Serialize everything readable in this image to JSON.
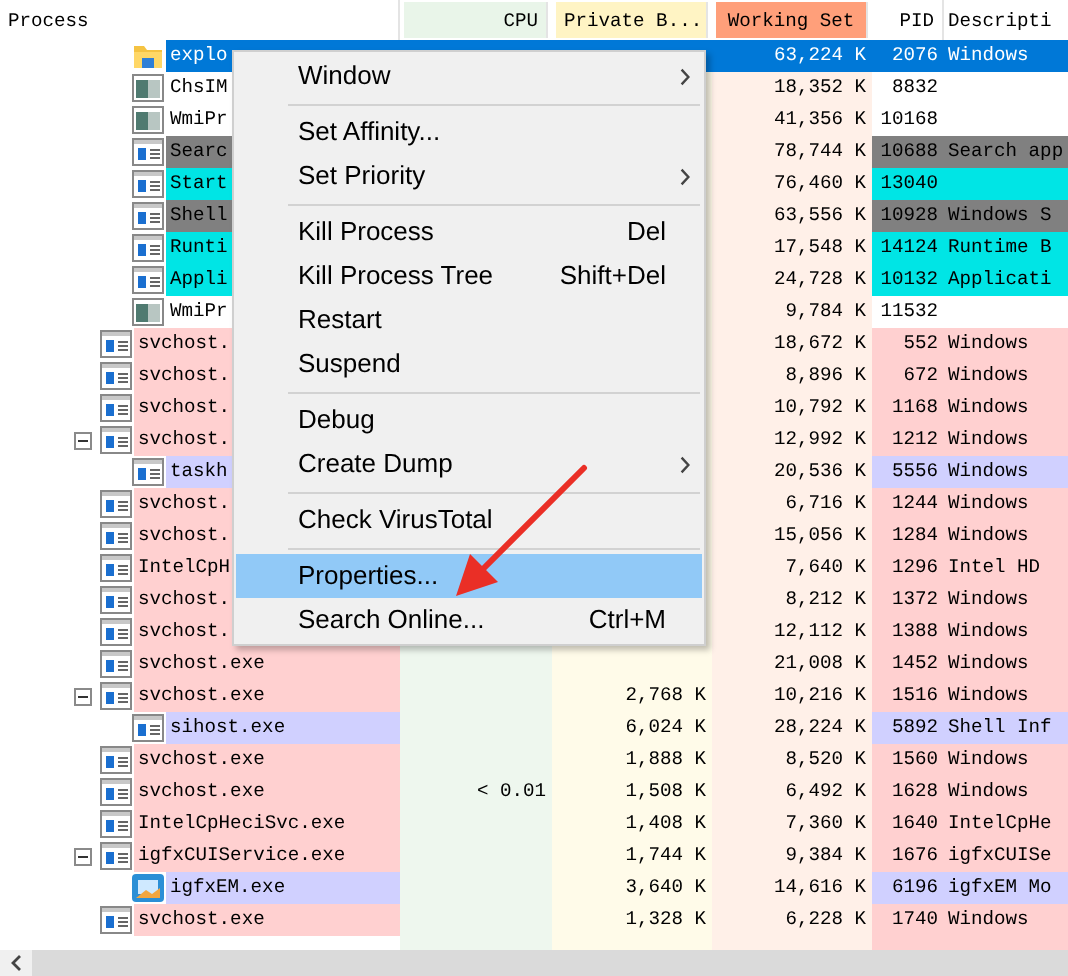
{
  "table": {
    "columns": [
      "Process",
      "CPU",
      "Private B...",
      "Working Set",
      "PID",
      "Descripti"
    ],
    "continued_children": [
      {
        "name": "explo",
        "kind": "folder",
        "selected": true,
        "working_set": "63,224 K",
        "pid": "2076",
        "description": "Windows"
      },
      {
        "name": "ChsIM",
        "kind": "app",
        "selected": false,
        "color": "#ffffff",
        "working_set": "18,352 K",
        "pid": "8832"
      },
      {
        "name": "WmiPr",
        "kind": "app",
        "selected": false,
        "color": "#ffffff",
        "working_set": "41,356 K",
        "pid": "10168"
      },
      {
        "name": "Searc",
        "kind": "service",
        "selected": false,
        "color": "#808080",
        "working_set": "78,744 K",
        "pid": "10688",
        "description": "Search app"
      },
      {
        "name": "Start",
        "kind": "service",
        "selected": false,
        "color": "#00e5e5",
        "working_set": "76,460 K",
        "pid": "13040"
      },
      {
        "name": "Shell",
        "kind": "service",
        "selected": false,
        "color": "#808080",
        "working_set": "63,556 K",
        "pid": "10928",
        "description": "Windows S"
      },
      {
        "name": "Runti",
        "kind": "service",
        "selected": false,
        "color": "#00e5e5",
        "working_set": "17,548 K",
        "pid": "14124",
        "description": "Runtime B"
      },
      {
        "name": "Appli",
        "kind": "service",
        "selected": false,
        "color": "#00e5e5",
        "working_set": "24,728 K",
        "pid": "10132",
        "description": "Applicati"
      },
      {
        "name": "WmiPr",
        "kind": "app",
        "selected": false,
        "color": "#ffffff",
        "working_set": "9,784 K",
        "pid": "11532"
      }
    ],
    "rows": [
      {
        "name": "svchost.",
        "kind": "service",
        "selected": false,
        "color": "#ffd0d0",
        "working_set": "18,672 K",
        "pid": "552",
        "description": "Windows"
      },
      {
        "name": "svchost.",
        "kind": "service",
        "selected": false,
        "color": "#ffd0d0",
        "working_set": "8,896 K",
        "pid": "672",
        "description": "Windows"
      },
      {
        "name": "svchost.",
        "kind": "service",
        "selected": false,
        "color": "#ffd0d0",
        "working_set": "10,792 K",
        "pid": "1168",
        "description": "Windows"
      },
      {
        "name": "svchost.",
        "kind": "service",
        "selected": false,
        "color": "#ffd0d0",
        "working_set": "12,992 K",
        "pid": "1212",
        "description": "Windows",
        "expanded": true,
        "children": [
          {
            "name": "taskh",
            "kind": "service",
            "selected": false,
            "color": "#d0d0ff",
            "working_set": "20,536 K",
            "pid": "5556",
            "description": "Windows"
          }
        ]
      },
      {
        "name": "svchost.",
        "kind": "service",
        "selected": false,
        "color": "#ffd0d0",
        "working_set": "6,716 K",
        "pid": "1244",
        "description": "Windows"
      },
      {
        "name": "svchost.",
        "kind": "service",
        "selected": false,
        "color": "#ffd0d0",
        "working_set": "15,056 K",
        "pid": "1284",
        "description": "Windows"
      },
      {
        "name": "IntelCpH",
        "kind": "service",
        "selected": false,
        "color": "#ffd0d0",
        "working_set": "7,640 K",
        "pid": "1296",
        "description": "Intel HD"
      },
      {
        "name": "svchost.",
        "kind": "service",
        "selected": false,
        "color": "#ffd0d0",
        "working_set": "8,212 K",
        "pid": "1372",
        "description": "Windows"
      },
      {
        "name": "svchost.",
        "kind": "service",
        "selected": false,
        "color": "#ffd0d0",
        "working_set": "12,112 K",
        "pid": "1388",
        "description": "Windows"
      },
      {
        "name": "svchost.exe",
        "kind": "service",
        "selected": false,
        "color": "#ffd0d0",
        "working_set": "21,008 K",
        "pid": "1452",
        "description": "Windows"
      },
      {
        "name": "svchost.exe",
        "kind": "service",
        "selected": false,
        "color": "#ffd0d0",
        "private_bytes": "2,768 K",
        "working_set": "10,216 K",
        "pid": "1516",
        "description": "Windows",
        "expanded": true,
        "children": [
          {
            "name": "sihost.exe",
            "kind": "service",
            "selected": false,
            "color": "#d0d0ff",
            "private_bytes": "6,024 K",
            "working_set": "28,224 K",
            "pid": "5892",
            "description": "Shell Inf"
          }
        ]
      },
      {
        "name": "svchost.exe",
        "kind": "service",
        "selected": false,
        "color": "#ffd0d0",
        "private_bytes": "1,888 K",
        "working_set": "8,520 K",
        "pid": "1560",
        "description": "Windows"
      },
      {
        "name": "svchost.exe",
        "kind": "service",
        "selected": false,
        "color": "#ffd0d0",
        "cpu": "< 0.01",
        "private_bytes": "1,508 K",
        "working_set": "6,492 K",
        "pid": "1628",
        "description": "Windows"
      },
      {
        "name": "IntelCpHeciSvc.exe",
        "kind": "service",
        "selected": false,
        "color": "#ffd0d0",
        "private_bytes": "1,408 K",
        "working_set": "7,360 K",
        "pid": "1640",
        "description": "IntelCpHe"
      },
      {
        "name": "igfxCUIService.exe",
        "kind": "service",
        "selected": false,
        "color": "#ffd0d0",
        "private_bytes": "1,744 K",
        "working_set": "9,384 K",
        "pid": "1676",
        "description": "igfxCUISe",
        "expanded": true,
        "children": [
          {
            "name": "igfxEM.exe",
            "kind": "igfx",
            "selected": false,
            "color": "#d0d0ff",
            "private_bytes": "3,640 K",
            "working_set": "14,616 K",
            "pid": "6196",
            "description": "igfxEM Mo"
          }
        ]
      },
      {
        "name": "svchost.exe",
        "kind": "service",
        "selected": false,
        "color": "#ffd0d0",
        "private_bytes": "1,328 K",
        "working_set": "6,228 K",
        "pid": "1740",
        "description": "Windows"
      }
    ]
  },
  "context_menu": [
    {
      "kind": "item",
      "label": "Window",
      "submenu": true,
      "selected": false
    },
    {
      "kind": "separator"
    },
    {
      "kind": "item",
      "label": "Set Affinity...",
      "submenu": false,
      "selected": false
    },
    {
      "kind": "item",
      "label": "Set Priority",
      "submenu": true,
      "selected": false
    },
    {
      "kind": "separator"
    },
    {
      "kind": "item",
      "label": "Kill Process",
      "shortcut": "Del",
      "submenu": false,
      "selected": false
    },
    {
      "kind": "item",
      "label": "Kill Process Tree",
      "shortcut": "Shift+Del",
      "submenu": false,
      "selected": false
    },
    {
      "kind": "item",
      "label": "Restart",
      "submenu": false,
      "selected": false
    },
    {
      "kind": "item",
      "label": "Suspend",
      "submenu": false,
      "selected": false
    },
    {
      "kind": "separator"
    },
    {
      "kind": "item",
      "label": "Debug",
      "submenu": false,
      "selected": false
    },
    {
      "kind": "item",
      "label": "Create Dump",
      "submenu": true,
      "selected": false
    },
    {
      "kind": "separator"
    },
    {
      "kind": "item",
      "label": "Check VirusTotal",
      "submenu": false,
      "selected": false
    },
    {
      "kind": "separator"
    },
    {
      "kind": "item",
      "label": "Properties...",
      "submenu": false,
      "selected": true
    },
    {
      "kind": "item",
      "label": "Search Online...",
      "shortcut": "Ctrl+M",
      "submenu": false,
      "selected": false
    }
  ]
}
